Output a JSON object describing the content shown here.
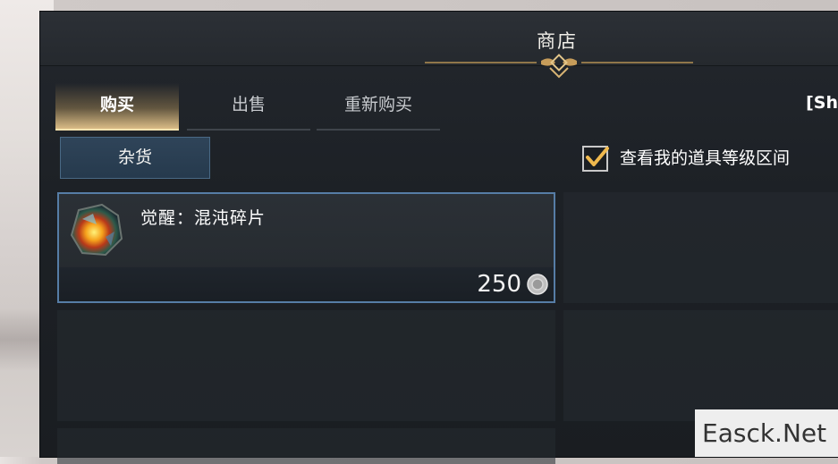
{
  "shop": {
    "title": "商店",
    "tabs": [
      {
        "label": "购买",
        "active": true
      },
      {
        "label": "出售",
        "active": false
      },
      {
        "label": "重新购买",
        "active": false
      }
    ],
    "server_tag": "[Sh",
    "category": "杂货",
    "filter_checkbox": {
      "label": "查看我的道具等级区间",
      "checked": true
    },
    "items": [
      {
        "name": "觉醒：混沌碎片",
        "price": "250",
        "currency_icon": "silver-coin-icon"
      }
    ]
  },
  "watermark": "Easck.Net",
  "colors": {
    "panel": "#1d2126",
    "accent_gold": "#e0b56a",
    "selection_blue": "#567da6",
    "category_blue": "#2f4459"
  }
}
